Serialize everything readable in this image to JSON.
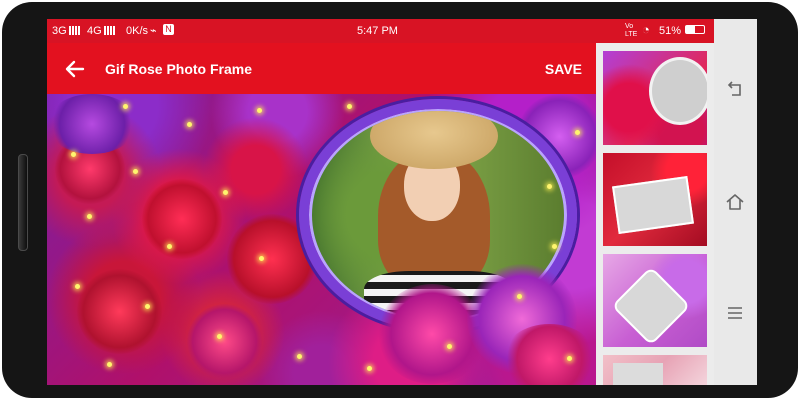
{
  "status_bar": {
    "network_left": "3G",
    "network_mid": "4G",
    "data_speed": "0K/s",
    "time": "5:47 PM",
    "volte": "Vo LTE",
    "battery": "51%"
  },
  "toolbar": {
    "title": "Gif Rose Photo Frame",
    "save_label": "SAVE"
  },
  "frame_thumbnails": [
    {
      "icon": "rose-oval-frame-icon"
    },
    {
      "icon": "rose-rect-frame-icon"
    },
    {
      "icon": "pink-heart-frame-icon"
    },
    {
      "icon": "pink-flower-frame-icon"
    }
  ],
  "colors": {
    "accent": "#e3111f",
    "status_bar": "#d81324"
  }
}
